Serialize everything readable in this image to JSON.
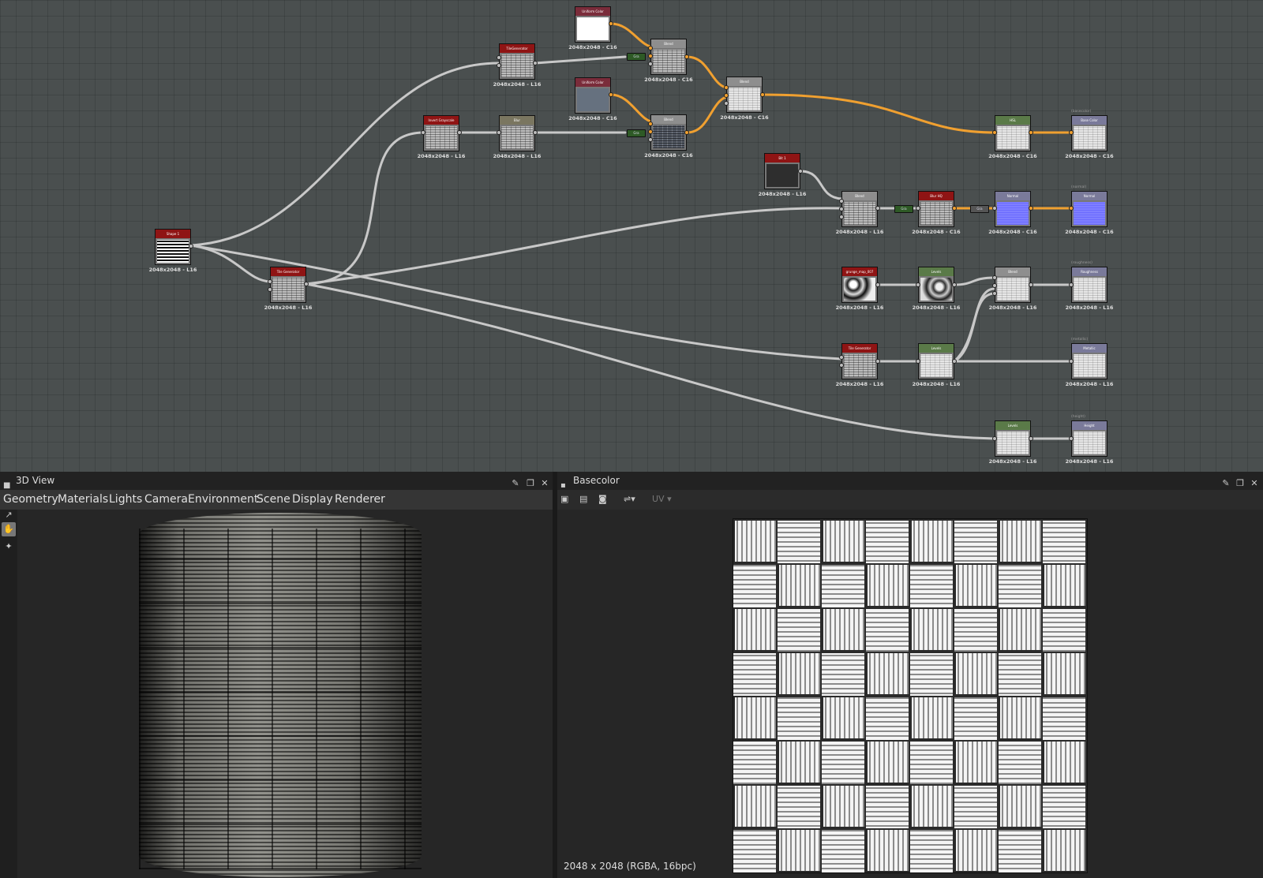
{
  "graph": {
    "nodes": [
      {
        "id": "shape",
        "title": "Shape 1",
        "label": "2048x2048 - L16"
      },
      {
        "id": "tilegen1",
        "title": "Tile Generator",
        "label": "2048x2048 - L16"
      },
      {
        "id": "tilegen2",
        "title": "TileGenerator",
        "label": "2048x2048 - L16"
      },
      {
        "id": "grad",
        "title": "Invert Grayscale",
        "label": "2048x2048 - L16"
      },
      {
        "id": "blur",
        "title": "Blur",
        "label": "2048x2048 - L16"
      },
      {
        "id": "uc1",
        "title": "Uniform Color",
        "label": "2048x2048 - C16"
      },
      {
        "id": "uc2",
        "title": "Uniform Color",
        "label": "2048x2048 - C16"
      },
      {
        "id": "blend1",
        "title": "Blend",
        "label": "2048x2048 - C16"
      },
      {
        "id": "blend2",
        "title": "Blend",
        "label": "2048x2048 - C16"
      },
      {
        "id": "blend3",
        "title": "Blend",
        "label": "2048x2048 - C16"
      },
      {
        "id": "hsl",
        "title": "HSL",
        "label": "2048x2048 - C16"
      },
      {
        "id": "out_base",
        "title": "Base Color",
        "label": "2048x2048 - C16",
        "output": "(basecolor)"
      },
      {
        "id": "dark",
        "title": "Bit 1",
        "label": "2048x2048 - L16"
      },
      {
        "id": "blend4",
        "title": "Blend",
        "label": "2048x2048 - L16"
      },
      {
        "id": "blurhq",
        "title": "Blur HQ",
        "label": "2048x2048 - C16"
      },
      {
        "id": "normal",
        "title": "Normal",
        "label": "2048x2048 - C16"
      },
      {
        "id": "out_normal",
        "title": "Normal",
        "label": "2048x2048 - C16",
        "output": "(normal)"
      },
      {
        "id": "grunge",
        "title": "grunge_map_007",
        "label": "2048x2048 - L16"
      },
      {
        "id": "levels1",
        "title": "Levels",
        "label": "2048x2048 - L16"
      },
      {
        "id": "blend5",
        "title": "Blend",
        "label": "2048x2048 - L16"
      },
      {
        "id": "out_rough",
        "title": "Roughness",
        "label": "2048x2048 - L16",
        "output": "(roughness)"
      },
      {
        "id": "tilegen3",
        "title": "Tile Generator",
        "label": "2048x2048 - L16"
      },
      {
        "id": "levels2",
        "title": "Levels",
        "label": "2048x2048 - L16"
      },
      {
        "id": "out_metal",
        "title": "Metallic",
        "label": "2048x2048 - L16",
        "output": "(metallic)"
      },
      {
        "id": "levels3",
        "title": "Levels",
        "label": "2048x2048 - L16"
      },
      {
        "id": "out_height",
        "title": "Height",
        "label": "2048x2048 - L16",
        "output": "(height)"
      }
    ],
    "converter_label": "Gra"
  },
  "panel3d": {
    "title": "3D View",
    "menu": [
      "Geometry",
      "Materials",
      "Lights",
      "Camera",
      "Environment",
      "Scene",
      "Display",
      "Renderer"
    ]
  },
  "panel2d": {
    "title": "Basecolor",
    "uv_label": "UV",
    "status": "2048 x 2048 (RGBA, 16bpc)"
  },
  "colors": {
    "graph_bg": "#4a4f4f",
    "header_red": "#8f1414",
    "header_green": "#5a7a48",
    "header_gray": "#8e8e8e",
    "header_maroon": "#7a2c3a",
    "header_slate": "#7a7a9a",
    "link_orange": "#f0a030",
    "link_gray": "#c8c8c8"
  }
}
